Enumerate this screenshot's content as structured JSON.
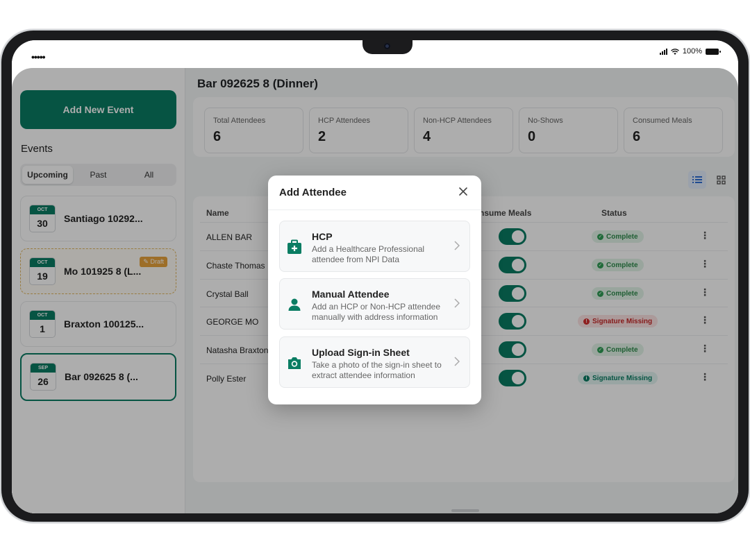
{
  "status_bar": {
    "battery": "100%",
    "signal_dots": "•••••"
  },
  "sidebar": {
    "add_event_label": "Add New Event",
    "events_title": "Events",
    "tabs": [
      {
        "label": "Upcoming",
        "active": true
      },
      {
        "label": "Past",
        "active": false
      },
      {
        "label": "All",
        "active": false
      }
    ],
    "events": [
      {
        "month": "OCT",
        "day": "30",
        "title": "Santiago 10292...",
        "draft": false,
        "selected": false
      },
      {
        "month": "OCT",
        "day": "19",
        "title": "Mo 101925 8 (L...",
        "draft": true,
        "draft_label": "Draft",
        "selected": false
      },
      {
        "month": "OCT",
        "day": "1",
        "title": "Braxton 100125...",
        "draft": false,
        "selected": false
      },
      {
        "month": "SEP",
        "day": "26",
        "title": "Bar 092625 8 (...",
        "draft": false,
        "selected": true
      }
    ]
  },
  "main": {
    "title": "Bar 092625 8 (Dinner)",
    "stats": [
      {
        "label": "Total Attendees",
        "value": "6"
      },
      {
        "label": "HCP Attendees",
        "value": "2"
      },
      {
        "label": "Non-HCP Attendees",
        "value": "4"
      },
      {
        "label": "No-Shows",
        "value": "0"
      },
      {
        "label": "Consumed Meals",
        "value": "6"
      }
    ],
    "table": {
      "columns": {
        "name": "Name",
        "consume": "nsume Meals",
        "status": "Status"
      },
      "rows": [
        {
          "name": "ALLEN BAR",
          "consume_meals": true,
          "status": "Complete",
          "status_type": "complete"
        },
        {
          "name": "Chaste Thomas I",
          "consume_meals": true,
          "status": "Complete",
          "status_type": "complete"
        },
        {
          "name": "Crystal Ball",
          "consume_meals": true,
          "status": "Complete",
          "status_type": "complete"
        },
        {
          "name": "GEORGE MO",
          "consume_meals": true,
          "status": "Signature Missing",
          "status_type": "missing"
        },
        {
          "name": "Natasha Braxton",
          "consume_meals": true,
          "status": "Complete",
          "status_type": "complete"
        },
        {
          "name": "Polly Ester",
          "consume_meals": true,
          "status": "Signature Missing",
          "status_type": "missing-teal"
        }
      ]
    }
  },
  "modal": {
    "title": "Add Attendee",
    "options": [
      {
        "title": "HCP",
        "description": "Add a Healthcare Professional attendee from NPI Data",
        "icon": "medical-kit-icon"
      },
      {
        "title": "Manual Attendee",
        "description": "Add an HCP or Non-HCP attendee manually with address information",
        "icon": "person-icon"
      },
      {
        "title": "Upload Sign-in Sheet",
        "description": "Take a photo of the sign-in sheet to extract attendee information",
        "icon": "camera-icon"
      }
    ]
  },
  "colors": {
    "brand": "#0a7d63",
    "complete_bg": "#e2f4e8",
    "complete_text": "#2e8b4c",
    "missing_bg": "#fde3e3",
    "missing_text": "#c62828",
    "draft": "#e8a33b"
  }
}
